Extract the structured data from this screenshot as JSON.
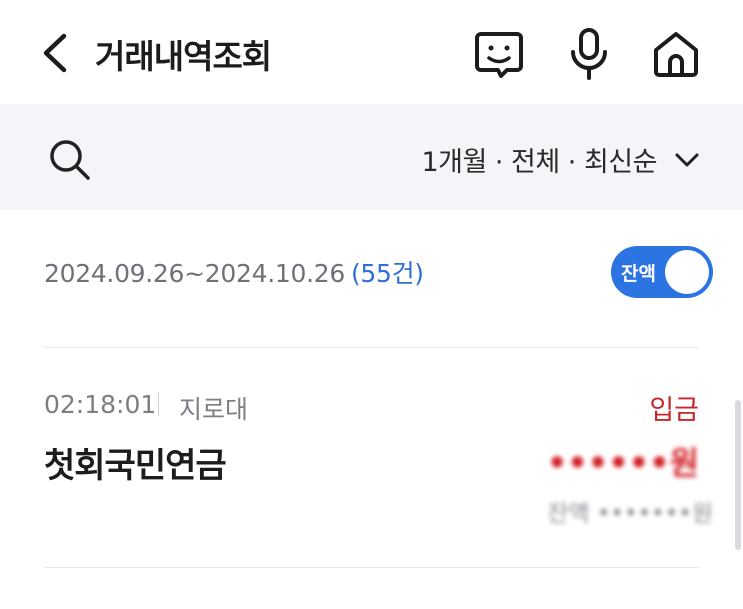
{
  "header": {
    "title": "거래내역조회",
    "icons": [
      "back-arrow-icon",
      "chatbot-icon",
      "microphone-icon",
      "home-icon"
    ]
  },
  "filter": {
    "label": "1개월 · 전체 · 최신순",
    "icons": [
      "search-icon",
      "chevron-down-icon"
    ]
  },
  "summary": {
    "range": "2024.09.26~2024.10.26",
    "count": "(55건)",
    "toggle_label": "잔액",
    "toggle_on": true
  },
  "transactions": [
    {
      "time": "02:18:01",
      "via": "지로대",
      "type": "입금",
      "description": "첫회국민연금",
      "amount": "••••••원",
      "balance": "잔액 •••••••원"
    }
  ],
  "colors": {
    "accent": "#2b74e2",
    "deposit": "#c8262b",
    "filter_bg": "#f3f5f9"
  }
}
